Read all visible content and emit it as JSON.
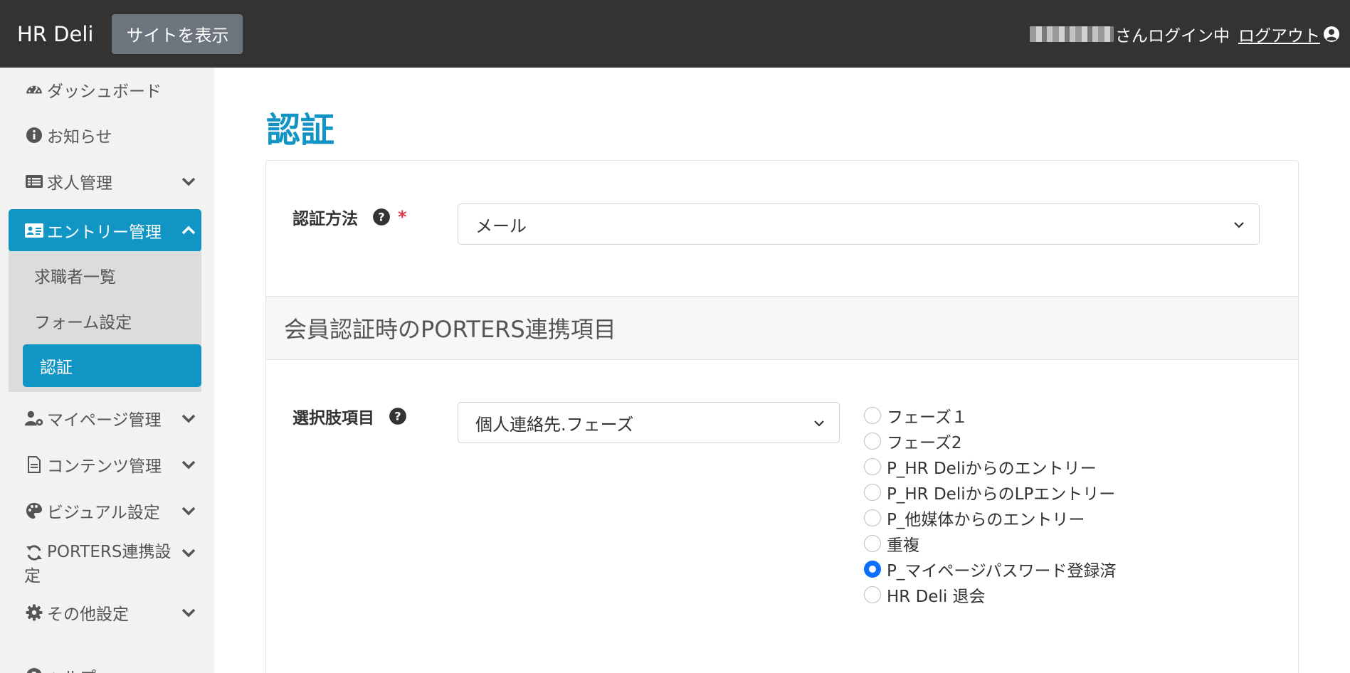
{
  "header": {
    "brand": "HR Deli",
    "view_site_button": "サイトを表示",
    "login_status": "さんログイン中",
    "logout_link": "ログアウト"
  },
  "sidebar": {
    "items": [
      {
        "label": "ダッシュボード",
        "icon": "dashboard-gauge-icon"
      },
      {
        "label": "お知らせ",
        "icon": "info-circle-icon"
      },
      {
        "label": "求人管理",
        "icon": "list-alt-icon",
        "expandable": true
      },
      {
        "label": "エントリー管理",
        "icon": "id-card-icon",
        "expandable": true,
        "expanded": true,
        "active": true
      },
      {
        "label": "マイページ管理",
        "icon": "user-cog-icon",
        "expandable": true
      },
      {
        "label": "コンテンツ管理",
        "icon": "file-icon",
        "expandable": true
      },
      {
        "label": "ビジュアル設定",
        "icon": "palette-icon",
        "expandable": true
      },
      {
        "label": "PORTERS連携設定",
        "icon": "sync-icon",
        "expandable": true
      },
      {
        "label": "その他設定",
        "icon": "gear-icon",
        "expandable": true
      },
      {
        "label": "ヘルプ",
        "icon": "question-circle-icon"
      }
    ],
    "submenu": [
      {
        "label": "求職者一覧"
      },
      {
        "label": "フォーム設定"
      },
      {
        "label": "認証",
        "active": true
      }
    ]
  },
  "main": {
    "title": "認証",
    "auth_method": {
      "label": "認証方法",
      "required_mark": "*",
      "value": "メール"
    },
    "section_title": "会員認証時のPORTERS連携項目",
    "choice_field": {
      "label": "選択肢項目",
      "value": "個人連絡先.フェーズ",
      "options": [
        {
          "label": "フェーズ１",
          "checked": false
        },
        {
          "label": "フェーズ2",
          "checked": false
        },
        {
          "label": "P_HR Deliからのエントリー",
          "checked": false
        },
        {
          "label": "P_HR DeliからのLPエントリー",
          "checked": false
        },
        {
          "label": "P_他媒体からのエントリー",
          "checked": false
        },
        {
          "label": "重複",
          "checked": false
        },
        {
          "label": "P_マイページパスワード登録済",
          "checked": true
        },
        {
          "label": "HR Deli 退会",
          "checked": false
        }
      ]
    }
  },
  "colors": {
    "header_bg": "#333333",
    "accent": "#1195c4",
    "radio_checked": "#0d6efd",
    "required": "#dc3545"
  }
}
